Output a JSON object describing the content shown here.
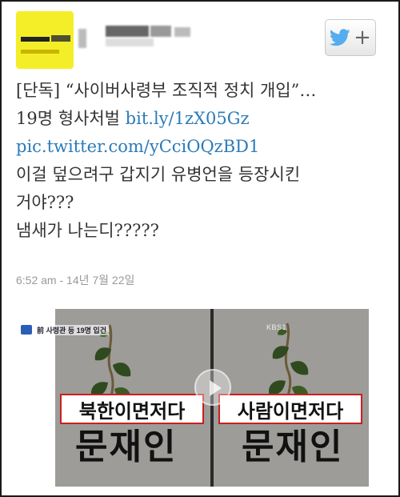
{
  "tweet": {
    "lines": [
      "[단독] “사이버사령부 조직적 정치 개입”…",
      "19명 형사처벌 ",
      "이걸 덮으려구 갑지기 유병언을 등장시킨",
      "거야???",
      "냄새가 나는디?????"
    ],
    "link_short": "bit.ly/1zX05Gz",
    "link_pic": "pic.twitter.com/yCciOQzBD1",
    "timestamp": "6:52 am - 14년 7월 22일"
  },
  "media": {
    "left_ticker": "前 사령관 등 19명 입건",
    "channel_logo": "KBS1",
    "left_caption": "북한이면저다",
    "right_caption": "사람이면저다",
    "left_name": "문재인",
    "right_name": "문재인"
  },
  "colors": {
    "link": "#2b7bb9",
    "twitter_blue": "#55acee",
    "avatar_yellow": "#f4ee28",
    "caption_border": "#c82020"
  },
  "icons": {
    "follow": "twitter-bird-icon",
    "add": "plus-icon",
    "play": "play-icon"
  }
}
